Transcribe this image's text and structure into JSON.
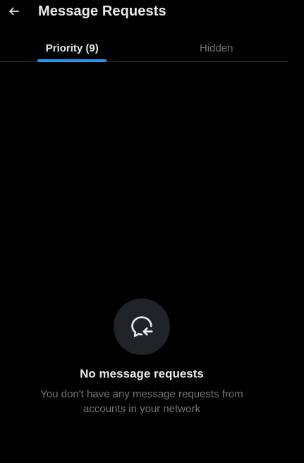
{
  "header": {
    "back_icon": "arrow-left-icon",
    "title": "Message Requests"
  },
  "tabs": [
    {
      "label": "Priority (9)",
      "active": true
    },
    {
      "label": "Hidden",
      "active": false
    }
  ],
  "empty_state": {
    "icon": "message-request-icon",
    "title": "No message requests",
    "subtitle": "You don't have any message requests from accounts in your network"
  },
  "colors": {
    "background": "#000000",
    "accent": "#1d9bf0",
    "primary_text": "#e7e9ea",
    "secondary_text": "#71767b",
    "icon_circle": "#202327",
    "divider": "#2f3336"
  }
}
